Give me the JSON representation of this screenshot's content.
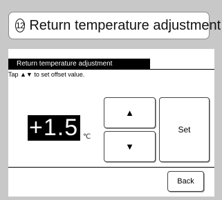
{
  "title": {
    "number": "12",
    "text": "Return temperature adjustment"
  },
  "screen": {
    "header": "Return temperature adjustment",
    "instruction": "Tap ▲▼ to set offset value.",
    "value": "+1.5",
    "unit": "℃",
    "buttons": {
      "up": "▲",
      "down": "▼",
      "set": "Set",
      "back": "Back"
    }
  },
  "colors": {
    "background": "#c8c8c8",
    "screen": "#ffffff",
    "highlight": "#000000"
  }
}
